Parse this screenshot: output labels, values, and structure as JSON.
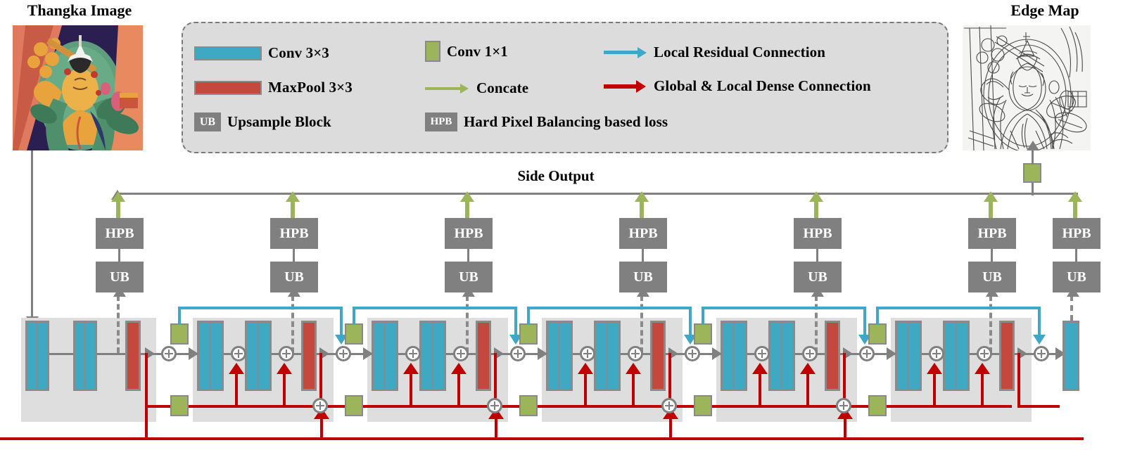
{
  "figure": {
    "type": "diagram",
    "subject": "Thangka image edge detection network architecture",
    "input_title": "Thangka Image",
    "output_title": "Edge Map",
    "side_output_label": "Side Output"
  },
  "legend": {
    "items": [
      {
        "id": "conv3",
        "icon": "conv-3x3-swatch",
        "label": "Conv 3×3"
      },
      {
        "id": "maxpool",
        "icon": "maxpool-3x3-swatch",
        "label": "MaxPool 3×3"
      },
      {
        "id": "ub",
        "icon": "upsample-block-badge",
        "badge": "UB",
        "label": "Upsample Block"
      },
      {
        "id": "conv1",
        "icon": "conv-1x1-swatch",
        "label": "Conv 1×1"
      },
      {
        "id": "concate",
        "icon": "concate-arrow",
        "label": "Concate"
      },
      {
        "id": "hpb",
        "icon": "hpb-badge",
        "badge": "HPB",
        "label": "Hard Pixel Balancing based loss"
      },
      {
        "id": "lrc",
        "icon": "local-residual-arrow",
        "label": "Local Residual Connection"
      },
      {
        "id": "gldc",
        "icon": "global-dense-arrow",
        "label": "Global & Local Dense Connection"
      }
    ]
  },
  "blocks": {
    "ub_label": "UB",
    "hpb_label": "HPB"
  },
  "stages": [
    {
      "index": 1,
      "conv_count": 2,
      "has_pool": true,
      "has_hpb": true
    },
    {
      "index": 2,
      "conv_count": 2,
      "has_pool": true,
      "has_hpb": true
    },
    {
      "index": 3,
      "conv_count": 2,
      "has_pool": true,
      "has_hpb": true
    },
    {
      "index": 4,
      "conv_count": 2,
      "has_pool": true,
      "has_hpb": true
    },
    {
      "index": 5,
      "conv_count": 2,
      "has_pool": true,
      "has_hpb": true
    },
    {
      "index": 6,
      "conv_count": 2,
      "has_pool": true,
      "has_hpb": true
    },
    {
      "index": 7,
      "conv_count": 1,
      "has_pool": false,
      "has_hpb": true
    }
  ],
  "colors": {
    "conv": "#3fa9c4",
    "maxpool": "#c4483d",
    "conv1x1": "#9cb55b",
    "block_gray": "#808080",
    "stage_panel": "#dedede",
    "legend_bg": "#dcdcdc",
    "residual_cyan": "#3fa8c9",
    "dense_red": "#c00000",
    "flow_gray": "#808080"
  }
}
